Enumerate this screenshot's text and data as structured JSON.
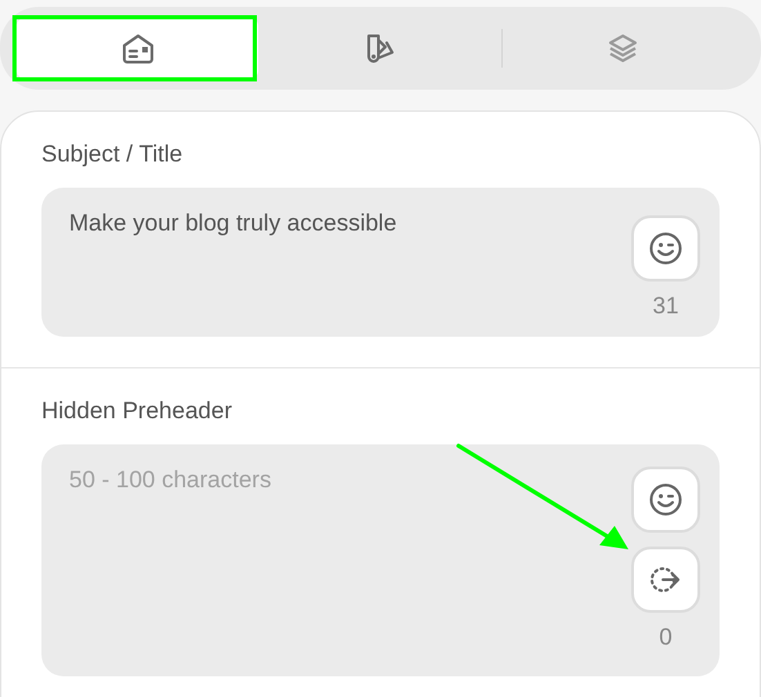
{
  "tabs": [
    {
      "kind": "envelope",
      "selected": true
    },
    {
      "kind": "swatches",
      "selected": false
    },
    {
      "kind": "layers",
      "selected": false
    }
  ],
  "sections": [
    {
      "label": "Subject / Title",
      "value": "Make your blog truly accessible",
      "count": "31",
      "tools": [
        {
          "kind": "emoji"
        }
      ]
    },
    {
      "label": "Hidden Preheader",
      "placeholder": "50 - 100 characters",
      "count": "0",
      "tools": [
        {
          "kind": "emoji"
        },
        {
          "kind": "generate"
        }
      ]
    }
  ]
}
